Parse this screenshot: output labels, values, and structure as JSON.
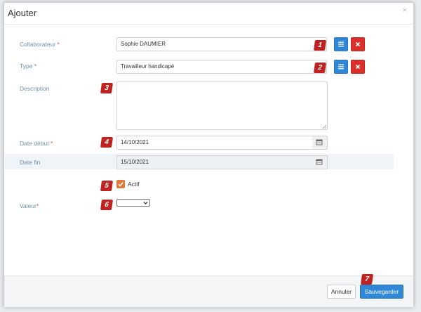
{
  "modal": {
    "title": "Ajouter",
    "close_glyph": "×"
  },
  "form": {
    "collaborateur": {
      "label": "Collaborateur ",
      "required_mark": "*",
      "value": "Sophie DAUMIER",
      "badge": "1"
    },
    "type": {
      "label": "Type ",
      "required_mark": "*",
      "value": "Travailleur handicapé",
      "badge": "2"
    },
    "description": {
      "label": "Description",
      "value": "",
      "badge": "3"
    },
    "date_debut": {
      "label": "Date début ",
      "required_mark": "*",
      "value": "14/10/2021",
      "badge": "4"
    },
    "date_fin": {
      "label": "Date fin",
      "value": "15/10/2021"
    },
    "actif": {
      "label": "Actif",
      "checked": true,
      "badge": "5"
    },
    "valeur": {
      "label": "Valeur",
      "required_mark": "*",
      "value": "",
      "badge": "6"
    }
  },
  "footer": {
    "cancel_label": "Annuler",
    "save_label": "Sauvegarder",
    "badge": "7"
  },
  "colors": {
    "primary": "#2f87d6",
    "danger": "#d9302c",
    "badge": "#c0221f",
    "checkbox": "#e07a3b",
    "label": "#6f8fa4"
  },
  "icons": {
    "list_button": "list-icon",
    "clear_button": "close-icon",
    "calendar": "calendar-icon",
    "check": "check-icon"
  }
}
